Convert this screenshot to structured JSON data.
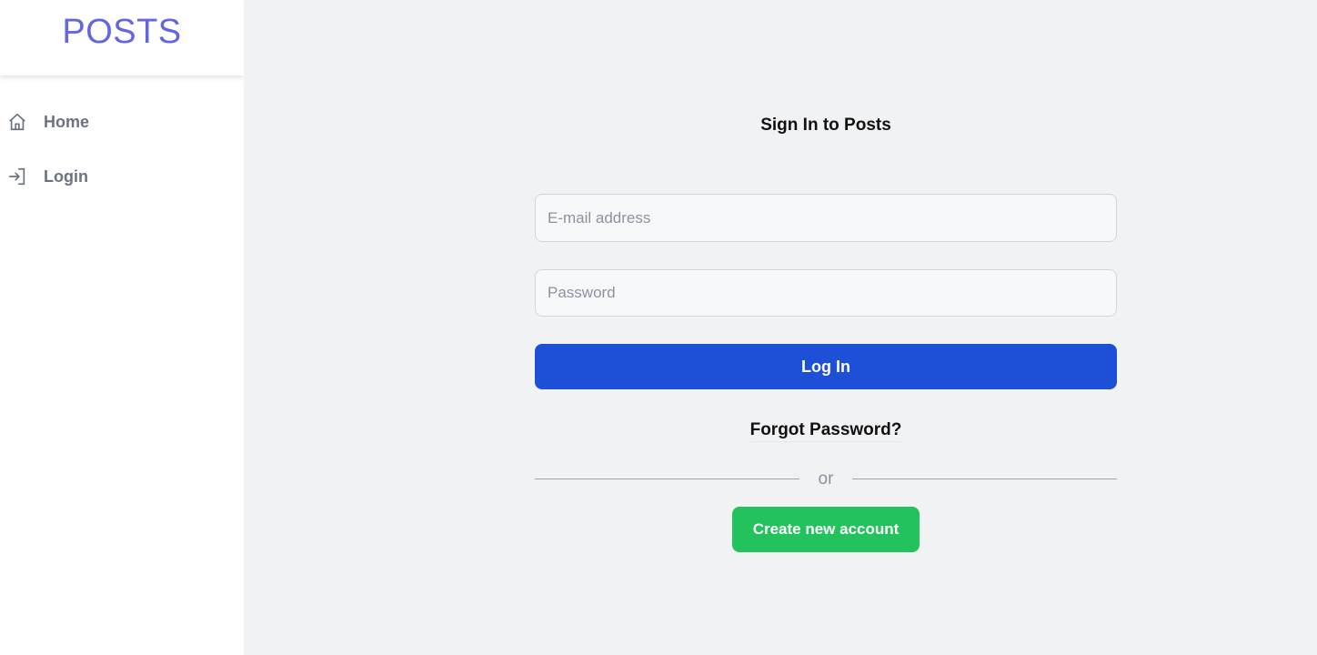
{
  "sidebar": {
    "brand": "POSTS",
    "items": [
      {
        "label": "Home",
        "icon": "home-icon"
      },
      {
        "label": "Login",
        "icon": "login-icon"
      }
    ]
  },
  "main": {
    "heading": "Sign In to Posts",
    "email": {
      "value": "",
      "placeholder": "E-mail address"
    },
    "password": {
      "value": "",
      "placeholder": "Password"
    },
    "login_button": "Log In",
    "forgot_link": "Forgot Password?",
    "divider_text": "or",
    "create_account_button": "Create new account"
  },
  "colors": {
    "brand": "#6366e0",
    "primary": "#1d4fd7",
    "success": "#22c25c",
    "background": "#f1f2f4",
    "sidebar": "#ffffff",
    "nav_text": "#6b7280"
  }
}
